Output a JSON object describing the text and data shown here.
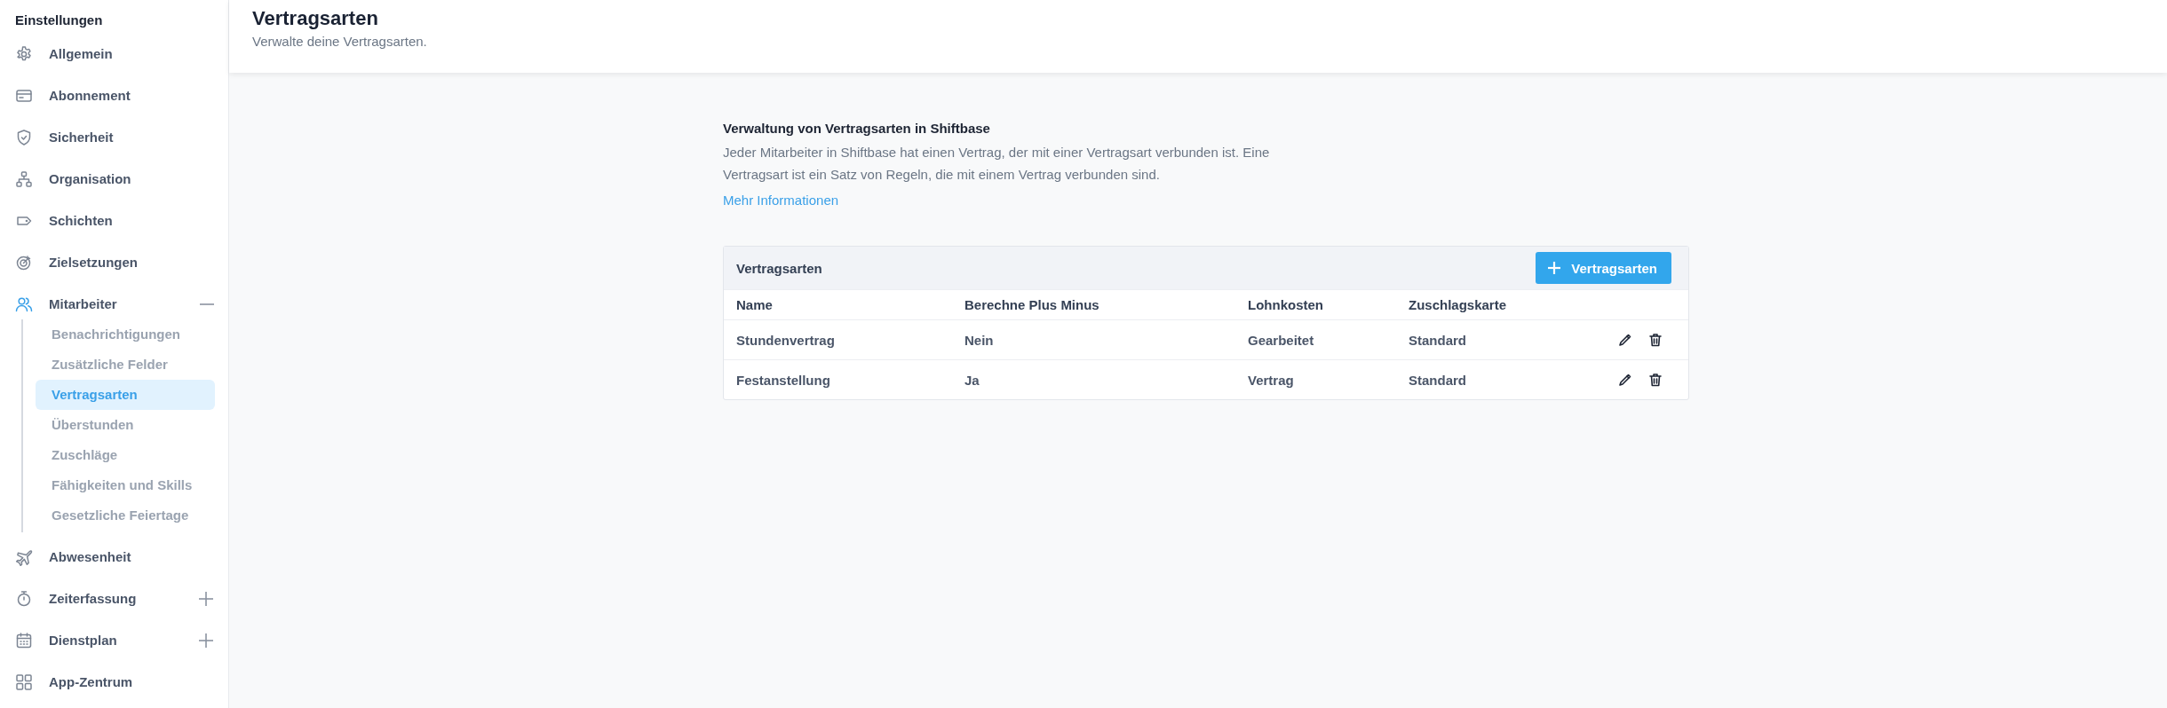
{
  "sidebar": {
    "title": "Einstellungen",
    "items": [
      {
        "label": "Allgemein",
        "kind": "link",
        "active": false
      },
      {
        "label": "Abonnement",
        "kind": "link",
        "active": false
      },
      {
        "label": "Sicherheit",
        "kind": "link",
        "active": false
      },
      {
        "label": "Organisation",
        "kind": "link",
        "active": false
      },
      {
        "label": "Schichten",
        "kind": "link",
        "active": false
      },
      {
        "label": "Zielsetzungen",
        "kind": "link",
        "active": false
      },
      {
        "label": "Mitarbeiter",
        "kind": "group",
        "active": true,
        "expanded": true,
        "children": [
          {
            "label": "Benachrichtigungen",
            "selected": false
          },
          {
            "label": "Zusätzliche Felder",
            "selected": false
          },
          {
            "label": "Vertragsarten",
            "selected": true
          },
          {
            "label": "Überstunden",
            "selected": false
          },
          {
            "label": "Zuschläge",
            "selected": false
          },
          {
            "label": "Fähigkeiten und Skills",
            "selected": false
          },
          {
            "label": "Gesetzliche Feiertage",
            "selected": false
          }
        ]
      },
      {
        "label": "Abwesenheit",
        "kind": "link",
        "active": false
      },
      {
        "label": "Zeiterfassung",
        "kind": "group",
        "active": false,
        "expanded": false
      },
      {
        "label": "Dienstplan",
        "kind": "group",
        "active": false,
        "expanded": false
      },
      {
        "label": "App-Zentrum",
        "kind": "link",
        "active": false
      }
    ]
  },
  "header": {
    "title": "Vertragsarten",
    "subtitle": "Verwalte deine Vertragsarten."
  },
  "intro": {
    "heading": "Verwaltung von Vertragsarten in Shiftbase",
    "text": "Jeder Mitarbeiter in Shiftbase hat einen Vertrag, der mit einer Vertragsart verbunden ist. Eine Vertragsart ist ein Satz von Regeln, die mit einem Vertrag verbunden sind.",
    "link": "Mehr Informationen"
  },
  "table": {
    "title": "Vertragsarten",
    "add_button": "Vertragsarten",
    "columns": [
      "Name",
      "Berechne Plus Minus",
      "Lohnkosten",
      "Zuschlagskarte"
    ],
    "rows": [
      [
        "Stundenvertrag",
        "Nein",
        "Gearbeitet",
        "Standard"
      ],
      [
        "Festanstellung",
        "Ja",
        "Vertrag",
        "Standard"
      ]
    ]
  }
}
